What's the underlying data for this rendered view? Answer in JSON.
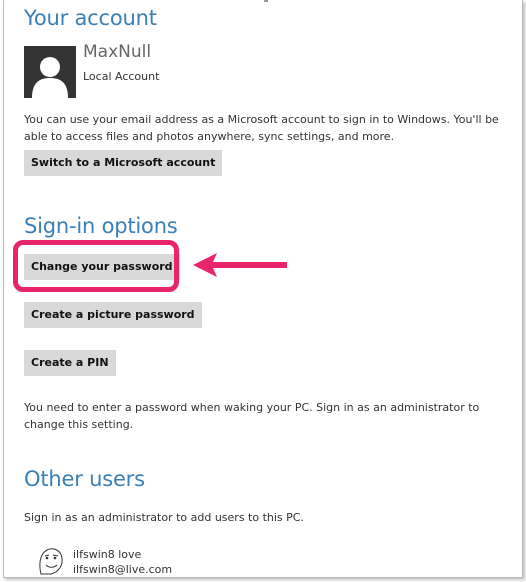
{
  "account": {
    "heading": "Your account",
    "user_name": "MaxNull",
    "user_type": "Local Account",
    "description": "You can use your email address as a Microsoft account to sign in to Windows. You'll be able to access files and photos anywhere, sync settings, and more.",
    "switch_button": "Switch to a Microsoft account"
  },
  "signin": {
    "heading": "Sign-in options",
    "change_password_button": "Change your password",
    "picture_password_button": "Create a picture password",
    "pin_button": "Create a PIN",
    "note": "You need to enter a password when waking your PC. Sign in as an administrator to change this setting."
  },
  "other_users": {
    "heading": "Other users",
    "note": "Sign in as an administrator to add users to this PC.",
    "users": [
      {
        "name": "ilfswin8 love",
        "email": "ilfswin8@live.com"
      }
    ]
  },
  "colors": {
    "heading": "#3a80b8",
    "button_bg": "#d9d9d9",
    "highlight": "#e8246a"
  },
  "icons": {
    "avatar": "user-silhouette-icon",
    "other_user_avatar": "meme-face-icon",
    "annotation": "arrow-left-icon"
  }
}
